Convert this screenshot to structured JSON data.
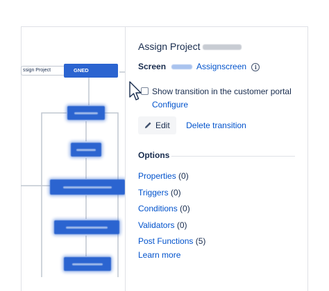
{
  "diagram": {
    "transition_label": "ssign Project",
    "assigned_status": "GNED",
    "box_color": "#2b64d0"
  },
  "panel": {
    "title": "Assign Project",
    "screen_label": "Screen",
    "screen_link": "Assignscreen",
    "checkbox_label": "Show transition in the customer portal",
    "configure_link": "Configure",
    "edit_button": "Edit",
    "delete_link": "Delete transition",
    "options_heading": "Options",
    "options": [
      {
        "name": "Properties",
        "count": "(0)"
      },
      {
        "name": "Triggers",
        "count": "(0)"
      },
      {
        "name": "Conditions",
        "count": "(0)"
      },
      {
        "name": "Validators",
        "count": "(0)"
      },
      {
        "name": "Post Functions",
        "count": "(5)"
      }
    ],
    "learn_more": "Learn more",
    "link_color": "#0052cc"
  }
}
